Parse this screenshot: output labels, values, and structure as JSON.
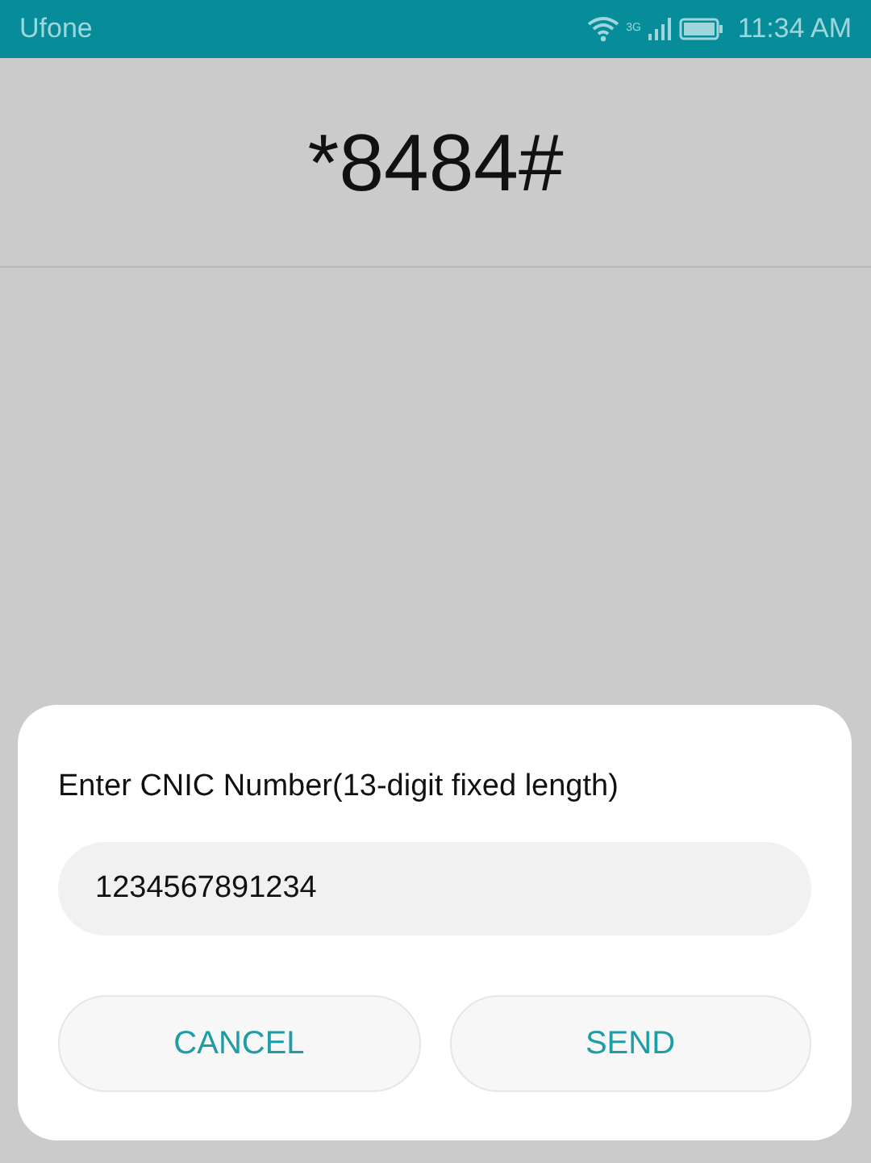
{
  "status_bar": {
    "carrier": "Ufone",
    "network": "3G",
    "time": "11:34 AM"
  },
  "code": "*8484#",
  "dialog": {
    "prompt": "Enter CNIC Number(13-digit fixed length)",
    "field": {
      "value": "1234567891234"
    },
    "buttons": [
      {
        "label": "CANCEL"
      },
      {
        "label": "SEND"
      }
    ]
  }
}
